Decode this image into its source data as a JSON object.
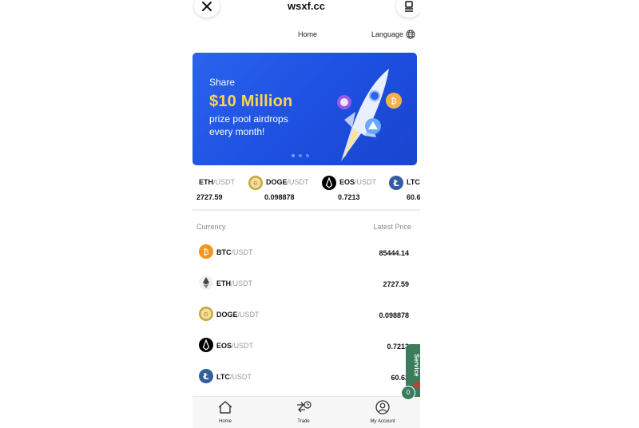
{
  "site_title": "wsxf.cc",
  "nav": {
    "home": "Home",
    "language": "Language"
  },
  "banner": {
    "line_share": "Share",
    "amount": "$10 Million",
    "line2": "prize pool airdrops",
    "line3": "every month!",
    "accent_color": "#ffd34d"
  },
  "ticker": [
    {
      "base": "ETH",
      "quote": "/USDT",
      "price": "2727.59",
      "icon": "ethereum-icon"
    },
    {
      "base": "DOGE",
      "quote": "/USDT",
      "price": "0.098878",
      "icon": "dogecoin-icon"
    },
    {
      "base": "EOS",
      "quote": "/USDT",
      "price": "0.7213",
      "icon": "eos-icon"
    },
    {
      "base": "LTC",
      "quote": "",
      "price": "60.6",
      "icon": "litecoin-icon"
    }
  ],
  "list": {
    "header_currency": "Currency",
    "header_price": "Latest Price",
    "rows": [
      {
        "base": "BTC",
        "quote": "/USDT",
        "price": "85444.14",
        "icon": "bitcoin-icon"
      },
      {
        "base": "ETH",
        "quote": "/USDT",
        "price": "2727.59",
        "icon": "ethereum-icon"
      },
      {
        "base": "DOGE",
        "quote": "/USDT",
        "price": "0.098878",
        "icon": "dogecoin-icon"
      },
      {
        "base": "EOS",
        "quote": "/USDT",
        "price": "0.7213",
        "icon": "eos-icon"
      },
      {
        "base": "LTC",
        "quote": "/USDT",
        "price": "60.62",
        "icon": "litecoin-icon"
      }
    ]
  },
  "service": {
    "label": "Service",
    "count": "0"
  },
  "bottom_nav": {
    "home": "Home",
    "trade": "Trade",
    "account": "My Account"
  }
}
